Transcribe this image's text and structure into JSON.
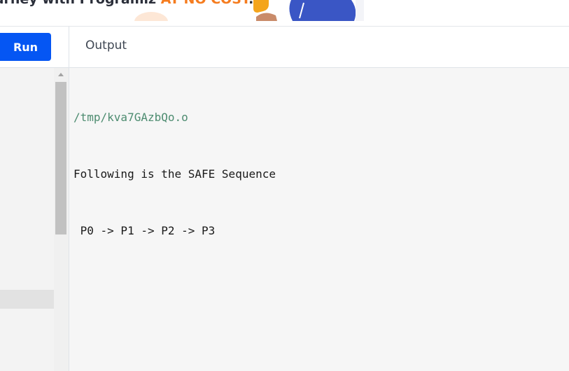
{
  "banner": {
    "text_prefix": "urney with Programiz ",
    "text_accent": "AT NO COST",
    "text_suffix": "."
  },
  "toolbar": {
    "run_label": "Run",
    "output_label": "Output"
  },
  "output": {
    "lines": [
      "/tmp/kva7GAzbQo.o",
      "Following is the SAFE Sequence",
      " P0 -> P1 -> P2 -> P3"
    ]
  },
  "colors": {
    "run_button": "#0556f3",
    "accent_orange": "#f57c1f",
    "path_green": "#4d8c70"
  }
}
